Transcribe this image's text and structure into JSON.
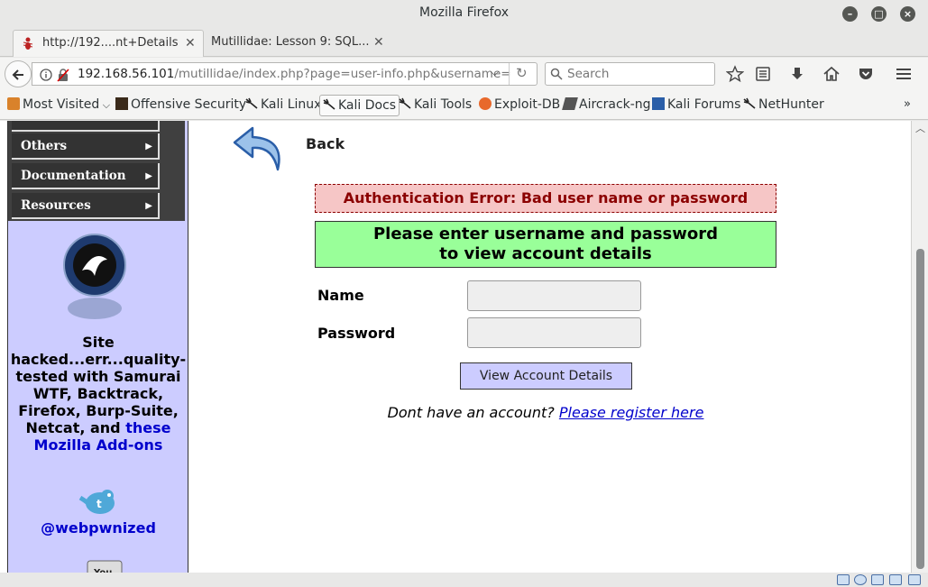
{
  "window": {
    "title": "Mozilla Firefox"
  },
  "tabs": [
    {
      "label": "http://192....nt+Details",
      "active": true
    },
    {
      "label": "Mutillidae: Lesson 9: SQL...",
      "active": false
    }
  ],
  "navbar": {
    "url_host": "192.168.56.101",
    "url_path": "/mutillidae/index.php?page=user-info.php&username=",
    "search_placeholder": "Search"
  },
  "bookmarks": [
    {
      "label": "Most Visited",
      "icon": "gear-icon",
      "has_chevron": true
    },
    {
      "label": "Offensive Security",
      "icon": "offsec-icon"
    },
    {
      "label": "Kali Linux",
      "icon": "kali-dragon-icon"
    },
    {
      "label": "Kali Docs",
      "icon": "kali-dragon-icon"
    },
    {
      "label": "Kali Tools",
      "icon": "kali-dragon-icon"
    },
    {
      "label": "Exploit-DB",
      "icon": "exploit-db-icon"
    },
    {
      "label": "Aircrack-ng",
      "icon": "aircrack-icon"
    },
    {
      "label": "Kali Forums",
      "icon": "kali-forums-icon"
    },
    {
      "label": "NetHunter",
      "icon": "kali-dragon-icon"
    }
  ],
  "sidebar": {
    "menu": [
      {
        "label": "Others"
      },
      {
        "label": "Documentation"
      },
      {
        "label": "Resources"
      }
    ],
    "blurb_text": "Site hacked...err...quality-tested with Samurai WTF, Backtrack, Firefox, Burp-Suite, Netcat, and ",
    "blurb_link": "these Mozilla Add-ons",
    "twitter_handle": "@webpwnized"
  },
  "main": {
    "back_label": "Back",
    "error_message": "Authentication Error: Bad user name or password",
    "prompt_line1": "Please enter username and password",
    "prompt_line2": "to view account details",
    "name_label": "Name",
    "password_label": "Password",
    "name_value": "",
    "password_value": "",
    "submit_label": "View Account Details",
    "register_prefix": "Dont have an account?",
    "register_link": "Please register here"
  },
  "colors": {
    "error_bg": "#f6c6c6",
    "error_text": "#8b0000",
    "prompt_bg": "#99ff99",
    "sidebar_bg": "#ccccff",
    "link": "#0000cc"
  }
}
